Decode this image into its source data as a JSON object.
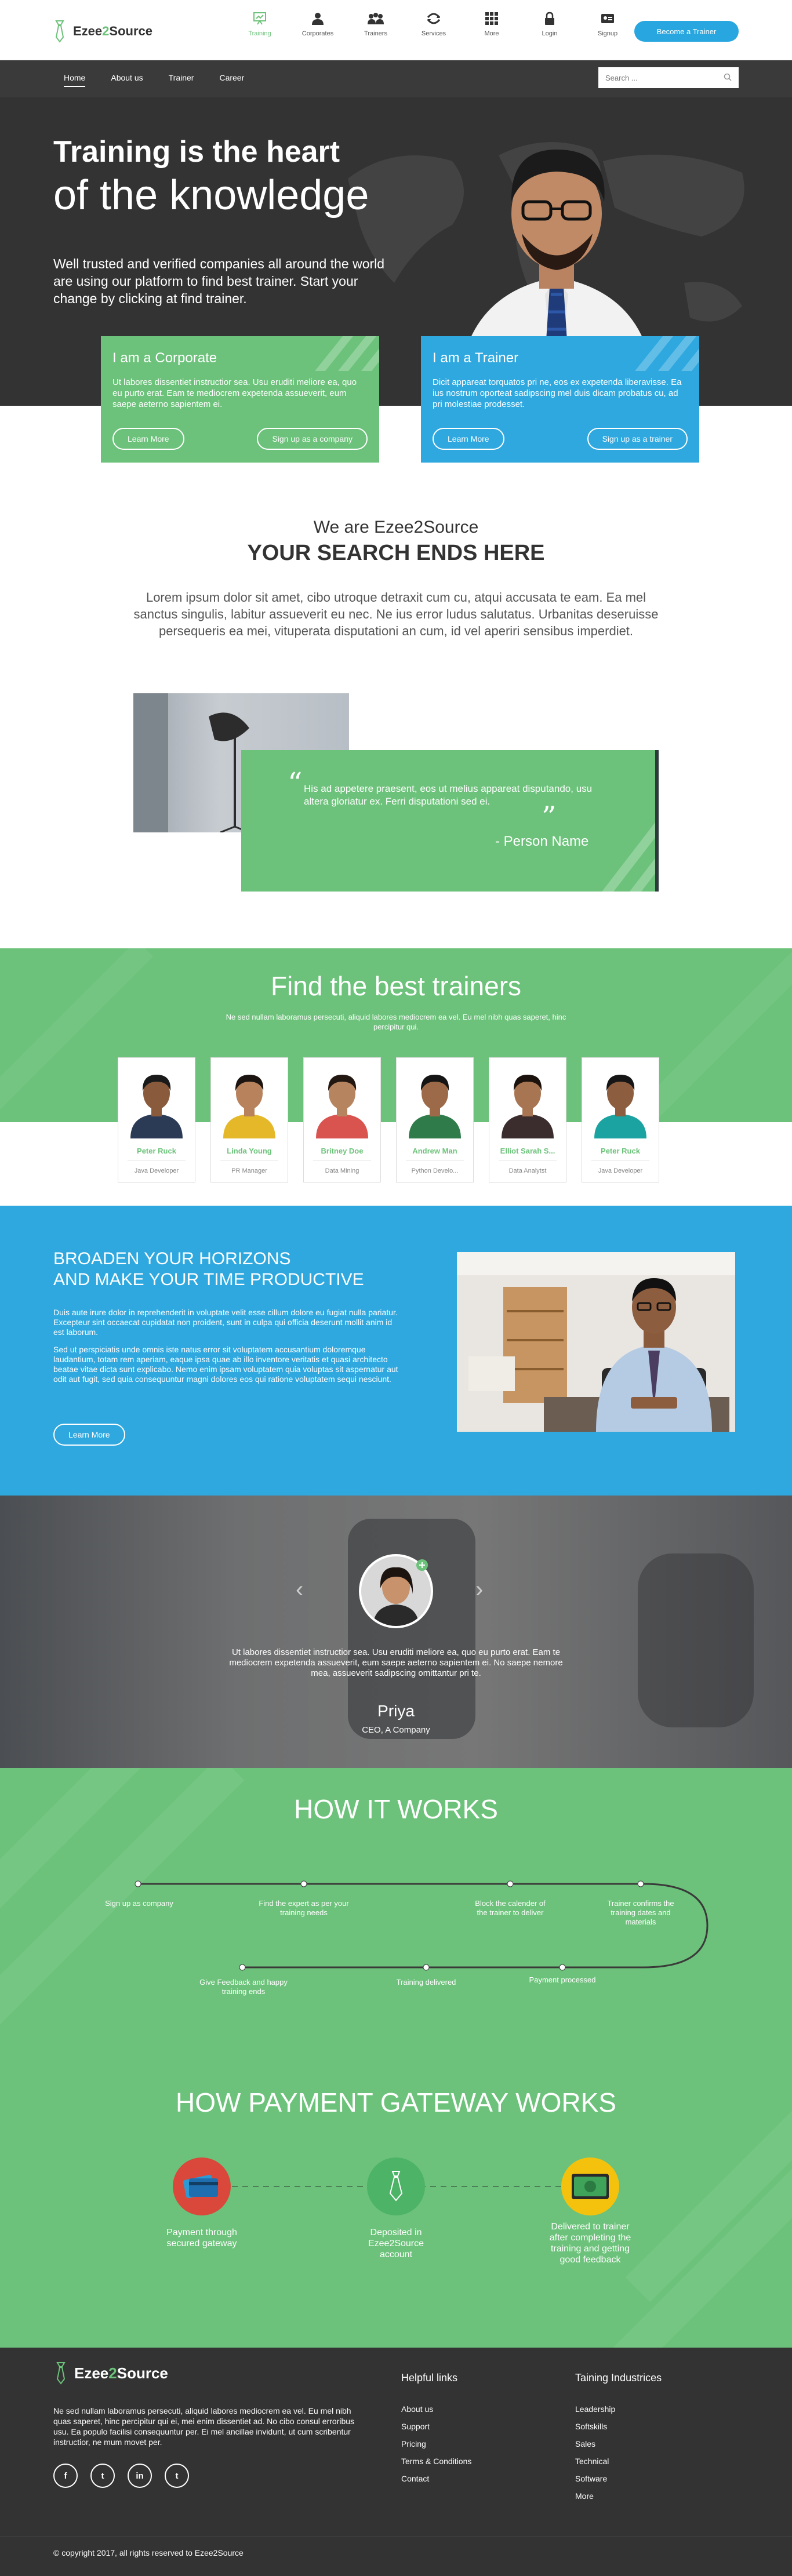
{
  "brand": {
    "name_prefix": "Ezee",
    "name_mid": "2",
    "name_suffix": "Source",
    "green": "#6cc27a",
    "blue": "#2ea8df",
    "dark": "#333333"
  },
  "topnav": {
    "items": [
      {
        "label": "Training",
        "icon": "training-icon"
      },
      {
        "label": "Corporates",
        "icon": "corporates-icon"
      },
      {
        "label": "Trainers",
        "icon": "trainers-icon"
      },
      {
        "label": "Services",
        "icon": "services-icon"
      },
      {
        "label": "More",
        "icon": "more-grid-icon"
      },
      {
        "label": "Login",
        "icon": "lock-icon"
      },
      {
        "label": "Signup",
        "icon": "signup-icon"
      }
    ],
    "cta": "Become a Trainer"
  },
  "subnav": {
    "links": [
      "Home",
      "About us",
      "Trainer",
      "Career"
    ],
    "search_placeholder": "Search ..."
  },
  "hero": {
    "title_bold": "Training is the heart",
    "title_light": "of the knowledge",
    "text": "Well trusted and verified companies all around the world are using our platform to find best trainer. Start your change by clicking at find trainer."
  },
  "cards": {
    "corporate": {
      "title": "I am a Corporate",
      "text": "Ut labores dissentiet instructior sea. Usu eruditi meliore ea, quo eu purto erat. Eam te mediocrem expetenda assueverit, eum saepe aeterno sapientem ei.",
      "learn": "Learn More",
      "signup": "Sign up as a company"
    },
    "trainer": {
      "title": "I am a Trainer",
      "text": "Dicit appareat torquatos pri ne, eos ex expetenda liberavisse. Ea ius nostrum oporteat sadipscing mel duis dicam probatus cu, ad pri molestiae prodesset.",
      "learn": "Learn More",
      "signup": "Sign up as a trainer"
    }
  },
  "about": {
    "eyebrow": "We are Ezee2Source",
    "title": "YOUR SEARCH ENDS HERE",
    "text": "Lorem ipsum dolor sit amet, cibo utroque detraxit cum cu, atqui accusata te eam. Ea mel sanctus singulis, labitur assueverit eu nec. Ne ius error ludus salutatus. Urbanitas deseruisse persequeris ea mei, vituperata disputationi an cum, id vel aperiri sensibus imperdiet.",
    "quote_open": "“",
    "quote": "His ad appetere praesent, eos ut melius appareat disputando, usu altera gloriatur ex. Ferri disputationi sed ei.",
    "quote_close": "”",
    "quote_author": "- Person Name"
  },
  "trainers": {
    "title": "Find the best trainers",
    "subtitle": "Ne sed nullam laboramus persecuti, aliquid labores mediocrem ea vel. Eu mel nibh quas saperet, hinc percipitur qui.",
    "list": [
      {
        "name": "Peter Ruck",
        "role": "Java Developer",
        "skin": "#8a5a3c",
        "hair": "#1a1a1a",
        "shirt": "#2b3a55"
      },
      {
        "name": "Linda Young",
        "role": "PR Manager",
        "skin": "#b7825c",
        "hair": "#1c1410",
        "shirt": "#e5b82a"
      },
      {
        "name": "Britney Doe",
        "role": "Data Mining",
        "skin": "#b78460",
        "hair": "#231711",
        "shirt": "#d9534f"
      },
      {
        "name": "Andrew Man",
        "role": "Python Develo...",
        "skin": "#9c6a48",
        "hair": "#151515",
        "shirt": "#2f7b4a"
      },
      {
        "name": "Elliot Sarah S...",
        "role": "Data Analytst",
        "skin": "#a87552",
        "hair": "#1b120d",
        "shirt": "#3b2d2d"
      },
      {
        "name": "Peter Ruck",
        "role": "Java Developer",
        "skin": "#8d5d3f",
        "hair": "#161616",
        "shirt": "#1aa3a0"
      }
    ]
  },
  "broaden": {
    "title_line1": "BROADEN YOUR HORIZONS",
    "title_line2": "AND MAKE YOUR TIME PRODUCTIVE",
    "p1": "Duis aute irure dolor in reprehenderit in voluptate velit esse cillum dolore eu fugiat nulla pariatur. Excepteur sint occaecat cupidatat non proident, sunt in culpa qui officia deserunt mollit anim id est laborum.",
    "p2": "Sed ut perspiciatis unde omnis iste natus error sit voluptatem accusantium doloremque laudantium, totam rem aperiam, eaque ipsa quae ab illo inventore veritatis et quasi architecto beatae vitae dicta sunt explicabo. Nemo enim ipsam voluptatem quia voluptas sit aspernatur aut odit aut fugit, sed quia consequuntur magni dolores eos qui ratione voluptatem sequi nesciunt.",
    "cta": "Learn More"
  },
  "testimonial": {
    "text": "Ut labores dissentiet instructior sea. Usu eruditi meliore ea, quo eu purto erat. Eam te mediocrem expetenda assueverit, eum saepe aeterno sapientem ei. No saepe nemore mea, assueverit sadipscing omittantur pri te.",
    "name": "Priya",
    "role": "CEO, A Company",
    "prev": "‹",
    "next": "›"
  },
  "how_it_works": {
    "title": "HOW IT WORKS",
    "steps": [
      "Sign up as company",
      "Find the expert as per your training needs",
      "Block the calender of the trainer to deliver",
      "Trainer confirms the training dates and materials",
      "Payment processed",
      "Training delivered",
      "Give Feedback and happy training ends"
    ]
  },
  "payment": {
    "title": "HOW PAYMENT GATEWAY WORKS",
    "steps": [
      "Payment through secured gateway",
      "Deposited in Ezee2Source account",
      "Delivered to trainer after completing the training and getting good feedback"
    ]
  },
  "footer": {
    "description": "Ne sed nullam laboramus persecuti, aliquid labores mediocrem ea vel. Eu mel nibh quas saperet, hinc percipitur qui ei, mei enim dissentiet ad. No cibo consul erroribus usu. Ea populo facilisi consequuntur per. Ei mel ancillae invidunt, ut cum scribentur instructior, ne mum movet per.",
    "social": [
      "f",
      "t",
      "in",
      "t"
    ],
    "helpful_title": "Helpful links",
    "helpful": [
      "About us",
      "Support",
      "Pricing",
      "Terms & Conditions",
      "Contact"
    ],
    "industries_title": "Taining Industrices",
    "industries": [
      "Leadership",
      "Softskills",
      "Sales",
      "Technical",
      "Software",
      "More"
    ],
    "copyright": "© copyright 2017, all rights reserved to Ezee2Source"
  }
}
